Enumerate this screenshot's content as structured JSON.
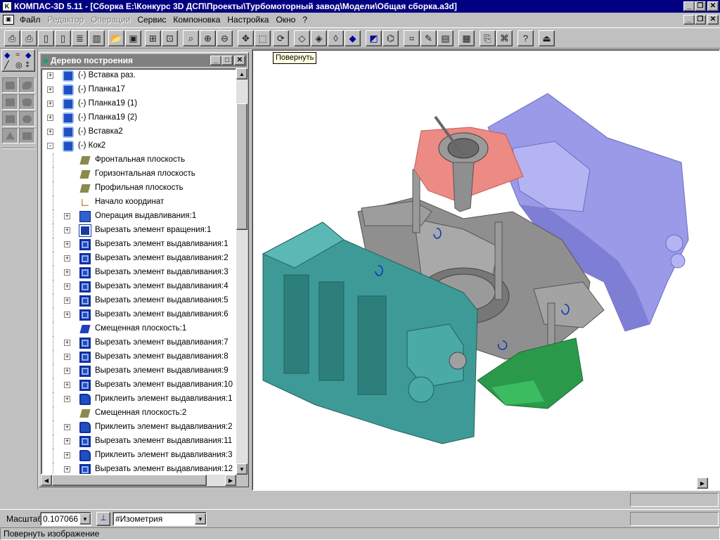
{
  "app": {
    "title": "КОМПАС-3D 5.11 - [Сборка Е:\\Конкурс 3D ДСП\\Проекты\\Турбомоторный завод\\Модели\\Общая сборка.a3d]"
  },
  "menu": {
    "items": [
      {
        "label": "Файл",
        "enabled": true
      },
      {
        "label": "Редактор",
        "enabled": false
      },
      {
        "label": "Операции",
        "enabled": false
      },
      {
        "label": "Сервис",
        "enabled": true
      },
      {
        "label": "Компоновка",
        "enabled": true
      },
      {
        "label": "Настройка",
        "enabled": true
      },
      {
        "label": "Окно",
        "enabled": true
      },
      {
        "label": "?",
        "enabled": true
      }
    ]
  },
  "toolbar": {
    "buttons": [
      {
        "icon": "print-preview-icon"
      },
      {
        "icon": "print-icon"
      },
      {
        "icon": "new-document-icon"
      },
      {
        "icon": "new-fragment-icon"
      },
      {
        "icon": "new-text-icon"
      },
      {
        "icon": "new-spec-icon"
      },
      {
        "icon": "open-folder-icon"
      },
      {
        "icon": "save-icon"
      },
      {
        "icon": "assembly-icon"
      },
      {
        "icon": "component-icon"
      },
      {
        "icon": "zoom-window-icon"
      },
      {
        "icon": "zoom-in-icon"
      },
      {
        "icon": "zoom-out-icon"
      },
      {
        "icon": "pan-icon"
      },
      {
        "icon": "zoom-all-icon"
      },
      {
        "icon": "rotate-icon"
      },
      {
        "icon": "wireframe-icon"
      },
      {
        "icon": "hidden-lines-icon"
      },
      {
        "icon": "thin-lines-icon"
      },
      {
        "icon": "shaded-icon"
      },
      {
        "icon": "perspective-icon"
      },
      {
        "icon": "tree-view-icon"
      },
      {
        "icon": "measure-icon"
      },
      {
        "icon": "edit-icon"
      },
      {
        "icon": "properties-icon"
      },
      {
        "icon": "calculator-icon"
      },
      {
        "icon": "document-preview-icon"
      },
      {
        "icon": "library-icon"
      },
      {
        "icon": "help-icon"
      },
      {
        "icon": "exit-icon"
      }
    ]
  },
  "tooltip": {
    "text": "Повернуть"
  },
  "tree": {
    "title": "Дерево построения",
    "items": [
      {
        "label": "(-) Вставка раз.",
        "level": 0,
        "expand": "+",
        "icon": "component-icon"
      },
      {
        "label": "(-) Планка17",
        "level": 0,
        "expand": "+",
        "icon": "component-icon"
      },
      {
        "label": "(-) Планка19 (1)",
        "level": 0,
        "expand": "+",
        "icon": "component-icon"
      },
      {
        "label": "(-) Планка19 (2)",
        "level": 0,
        "expand": "+",
        "icon": "component-icon"
      },
      {
        "label": "(-) Вставка2",
        "level": 0,
        "expand": "+",
        "icon": "component-icon"
      },
      {
        "label": "(-) Кок2",
        "level": 0,
        "expand": "-",
        "icon": "component-icon"
      },
      {
        "label": "Фронтальная плоскость",
        "level": 1,
        "expand": "",
        "icon": "plane-icon"
      },
      {
        "label": "Горизонтальная плоскость",
        "level": 1,
        "expand": "",
        "icon": "plane-icon"
      },
      {
        "label": "Профильная плоскость",
        "level": 1,
        "expand": "",
        "icon": "plane-icon"
      },
      {
        "label": "Начало координат",
        "level": 1,
        "expand": "",
        "icon": "origin-icon"
      },
      {
        "label": "Операция выдавливания:1",
        "level": 1,
        "expand": "+",
        "icon": "extrude-icon"
      },
      {
        "label": "Вырезать элемент вращения:1",
        "level": 1,
        "expand": "+",
        "icon": "cut-rotation-icon"
      },
      {
        "label": "Вырезать элемент выдавливания:1",
        "level": 1,
        "expand": "+",
        "icon": "cut-extrude-icon"
      },
      {
        "label": "Вырезать элемент выдавливания:2",
        "level": 1,
        "expand": "+",
        "icon": "cut-extrude-icon"
      },
      {
        "label": "Вырезать элемент выдавливания:3",
        "level": 1,
        "expand": "+",
        "icon": "cut-extrude-icon"
      },
      {
        "label": "Вырезать элемент выдавливания:4",
        "level": 1,
        "expand": "+",
        "icon": "cut-extrude-icon"
      },
      {
        "label": "Вырезать элемент выдавливания:5",
        "level": 1,
        "expand": "+",
        "icon": "cut-extrude-icon"
      },
      {
        "label": "Вырезать элемент выдавливания:6",
        "level": 1,
        "expand": "+",
        "icon": "cut-extrude-icon"
      },
      {
        "label": "Смещенная плоскость:1",
        "level": 1,
        "expand": "",
        "icon": "offset-plane-blue-icon"
      },
      {
        "label": "Вырезать элемент выдавливания:7",
        "level": 1,
        "expand": "+",
        "icon": "cut-extrude-icon"
      },
      {
        "label": "Вырезать элемент выдавливания:8",
        "level": 1,
        "expand": "+",
        "icon": "cut-extrude-icon"
      },
      {
        "label": "Вырезать элемент выдавливания:9",
        "level": 1,
        "expand": "+",
        "icon": "cut-extrude-icon"
      },
      {
        "label": "Вырезать элемент выдавливания:10",
        "level": 1,
        "expand": "+",
        "icon": "cut-extrude-icon"
      },
      {
        "label": "Приклеить элемент выдавливания:1",
        "level": 1,
        "expand": "+",
        "icon": "add-extrude-icon"
      },
      {
        "label": "Смещенная плоскость:2",
        "level": 1,
        "expand": "",
        "icon": "offset-plane-icon"
      },
      {
        "label": "Приклеить элемент выдавливания:2",
        "level": 1,
        "expand": "+",
        "icon": "add-extrude-icon"
      },
      {
        "label": "Вырезать элемент выдавливания:11",
        "level": 1,
        "expand": "+",
        "icon": "cut-extrude-icon"
      },
      {
        "label": "Приклеить элемент выдавливания:3",
        "level": 1,
        "expand": "+",
        "icon": "add-extrude-icon"
      },
      {
        "label": "Вырезать элемент выдавливания:12",
        "level": 1,
        "expand": "+",
        "icon": "cut-extrude-icon"
      }
    ]
  },
  "scale": {
    "label": "Масштаб",
    "value": "0.107066",
    "view": "#Изометрия"
  },
  "status": {
    "text": "Повернуть изображение"
  },
  "colors": {
    "titlebar": "#000080",
    "panel": "#c0c0c0",
    "teal": "#3e9a96",
    "violet": "#9a9ae8",
    "salmon": "#ec8a84",
    "green": "#2a9a4a",
    "gray": "#8f8f8f"
  }
}
